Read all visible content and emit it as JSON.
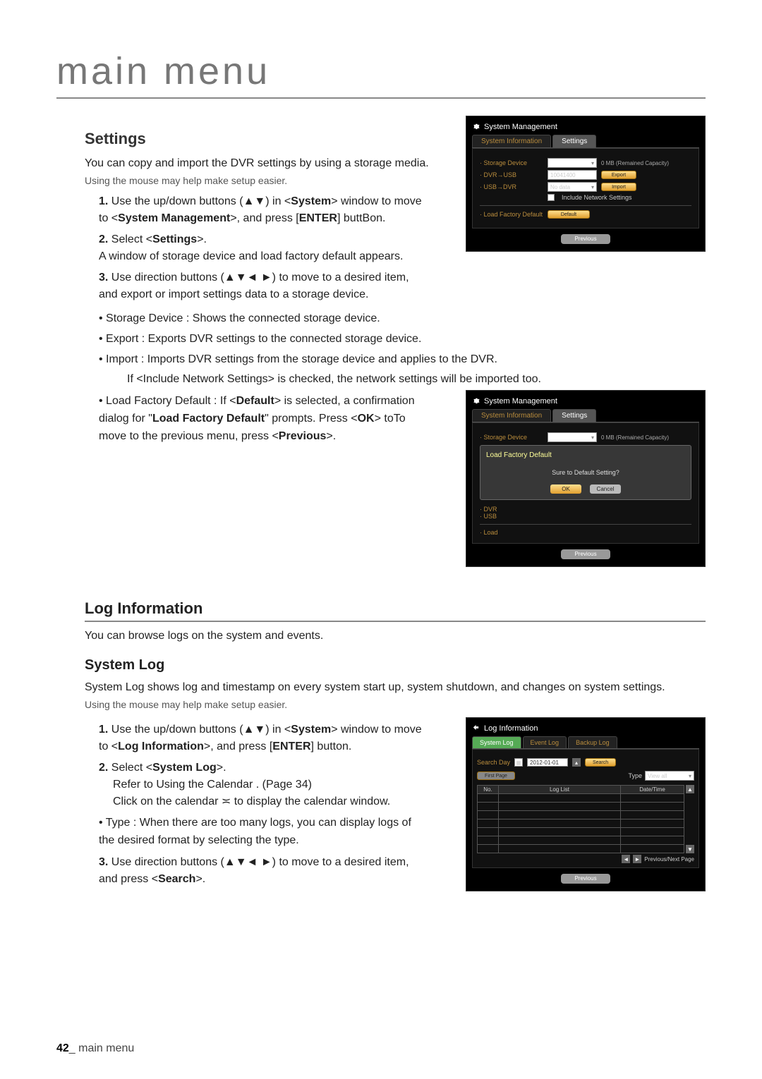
{
  "page_title": "main menu",
  "footer": {
    "page_number": "42",
    "section": "_ main menu"
  },
  "settings": {
    "heading": "Settings",
    "intro": "You can copy and import the DVR settings by using a storage media.",
    "mouse_note": "Using the mouse may help make setup easier.",
    "step1_num": "1.",
    "step1_a": "Use the up/down buttons (▲▼) in <",
    "step1_b": "System",
    "step1_c": "> window to move to <",
    "step1_d": "System Management",
    "step1_e": ">, and press [",
    "step1_f": "ENTER",
    "step1_g": "] buttBon.",
    "step2_num": "2.",
    "step2_a": "Select <",
    "step2_b": "Settings",
    "step2_c": ">.",
    "step2_follow": "A window of storage device and load factory default appears.",
    "step3_num": "3.",
    "step3": "Use direction buttons (▲▼◄ ►) to move to a desired item, and export or import settings data to a storage device.",
    "bullet_storage": "Storage Device : Shows the connected storage device.",
    "bullet_export": "Export : Exports DVR settings to the connected storage device.",
    "bullet_import": "Import : Imports DVR settings from the storage device and applies to the DVR.",
    "bullet_import_sub": "If <Include Network Settings> is checked, the network settings will be imported too.",
    "bullet_lfd_a": "Load Factory Default : If <",
    "bullet_lfd_b": "Default",
    "bullet_lfd_c": "> is selected, a confirmation dialog for \"",
    "bullet_lfd_d": "Load Factory Default",
    "bullet_lfd_e": "\" prompts. Press <",
    "bullet_lfd_f": "OK",
    "bullet_lfd_g": "> toTo move to the previous menu, press <",
    "bullet_lfd_h": "Previous",
    "bullet_lfd_i": ">."
  },
  "dialog_sm": {
    "title": "System Management",
    "tab_si": "System Information",
    "tab_settings": "Settings",
    "storage_device": "· Storage Device",
    "capacity": "0 MB (Remained Capacity)",
    "dvr_usb": "· DVR→USB",
    "dvr_usb_val": "10041400",
    "export": "Export",
    "usb_dvr": "· USB→DVR",
    "usb_dvr_val": "No data",
    "import": "Import",
    "checkbox_label": "Include Network Settings",
    "lfd_label": "· Load Factory Default",
    "default_btn": "Default",
    "previous": "Previous"
  },
  "confirm": {
    "title": "Load Factory Default",
    "msg": "Sure to Default Setting?",
    "ok": "OK",
    "cancel": "Cancel",
    "storage_stub": "· Storage Device",
    "dvr_stub": "· DVR",
    "usb_stub": "· USB",
    "load_stub": "· Load"
  },
  "loginfo": {
    "heading": "Log Information",
    "intro": "You can browse logs on the system and events."
  },
  "syslog": {
    "heading": "System Log",
    "intro": "System Log shows log and timestamp on every system start up, system shutdown, and changes on system settings.",
    "mouse_note": "Using the mouse may help make setup easier.",
    "step1_num": "1.",
    "step1_a": "Use the up/down buttons (▲▼) in <",
    "step1_b": "System",
    "step1_c": "> window to move to <",
    "step1_d": "Log Information",
    "step1_e": ">, and press [",
    "step1_f": "ENTER",
    "step1_g": "] button.",
    "step2_num": "2.",
    "step2_a": "Select <",
    "step2_b": "System Log",
    "step2_c": ">.",
    "step2_ref": "Refer to  Using the Calendar . (Page 34)",
    "step2_cal": "Click on the calendar ≍ to display the calendar window.",
    "bullet_type": "Type : When there are too many logs, you can display logs of the desired format by selecting the type.",
    "step3_num": "3.",
    "step3_a": "Use direction buttons (▲▼◄ ►) to move to a desired item, and press <",
    "step3_b": "Search",
    "step3_c": ">."
  },
  "dialog_log": {
    "title": "Log Information",
    "tab_sys": "System Log",
    "tab_event": "Event Log",
    "tab_backup": "Backup Log",
    "search_day": "Search Day",
    "date": "2012-01-01",
    "search_btn": "Search",
    "first_page": "First Page",
    "type_label": "Type",
    "type_value": "View all",
    "col_no": "No.",
    "col_list": "Log List",
    "col_dt": "Date/Time",
    "prev_next": "Previous/Next Page",
    "previous": "Previous"
  }
}
